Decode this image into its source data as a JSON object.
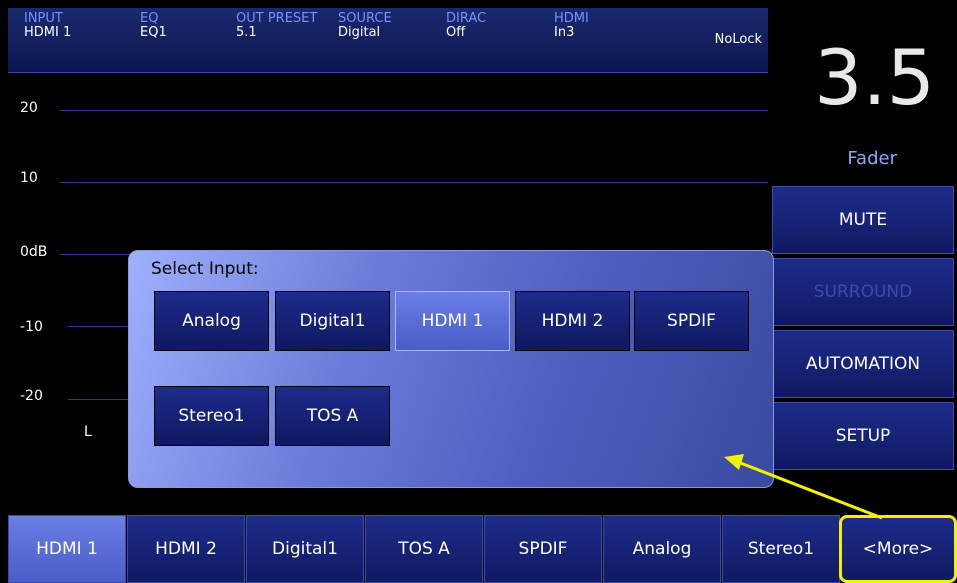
{
  "status": {
    "input": {
      "label": "INPUT",
      "value": "HDMI 1"
    },
    "eq": {
      "label": "EQ",
      "value": "EQ1"
    },
    "out_preset": {
      "label": "OUT PRESET",
      "value": "5.1"
    },
    "source": {
      "label": "SOURCE",
      "value": "Digital"
    },
    "dirac": {
      "label": "DIRAC",
      "value": "Off"
    },
    "hdmi": {
      "label": "HDMI",
      "value": "In3"
    },
    "lock": "NoLock"
  },
  "meter": {
    "gridlines": [
      "20",
      "10",
      "0dB",
      "-10",
      "-20"
    ],
    "channel": "L"
  },
  "fader": {
    "value": "3.5",
    "label": "Fader"
  },
  "side_buttons": [
    {
      "label": "MUTE",
      "enabled": true
    },
    {
      "label": "SURROUND",
      "enabled": false
    },
    {
      "label": "AUTOMATION",
      "enabled": true
    },
    {
      "label": "SETUP",
      "enabled": true
    }
  ],
  "dialog": {
    "title": "Select Input:",
    "options": [
      "Analog",
      "Digital1",
      "HDMI 1",
      "HDMI 2",
      "SPDIF",
      "Stereo1",
      "TOS A"
    ],
    "selected": "HDMI 1"
  },
  "bottom_tabs": [
    "HDMI 1",
    "HDMI 2",
    "Digital1",
    "TOS A",
    "SPDIF",
    "Analog",
    "Stereo1",
    "<More>"
  ],
  "active_tab": "HDMI 1",
  "colors": {
    "accent_blue": "#1d2c8c",
    "active": "#6b7ee6",
    "highlight": "#f2f200"
  }
}
